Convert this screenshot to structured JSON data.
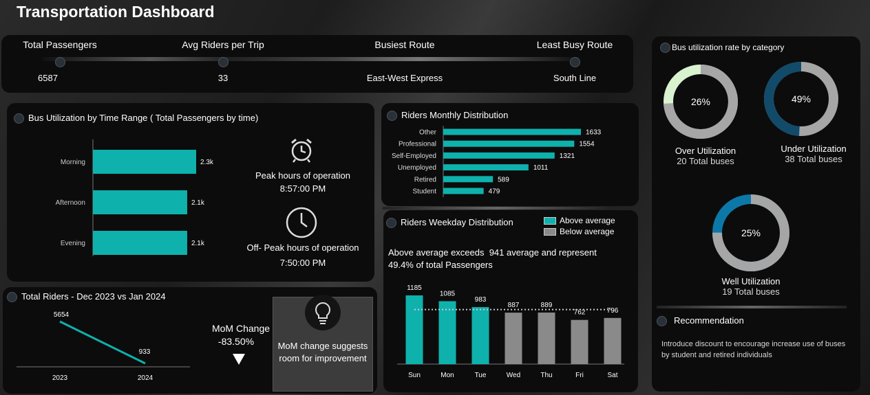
{
  "header": {
    "title": "Transportation Dashboard"
  },
  "kpis": [
    {
      "label": "Total Passengers",
      "value": "6587"
    },
    {
      "label": "Avg Riders per Trip",
      "value": "33"
    },
    {
      "label": "Busiest Route",
      "value": "East-West Express"
    },
    {
      "label": "Least Busy Route",
      "value": "South Line"
    }
  ],
  "time_range": {
    "title": "Bus Utilization by Time Range ( Total Passengers by time)",
    "peak_label": "Peak hours of operation",
    "peak_value": "8:57:00 PM",
    "offpeak_label": "Off- Peak hours of operation",
    "offpeak_value": "7:50:00 PM",
    "icons": {
      "peak": "alarm-clock-icon",
      "offpeak": "clock-icon"
    }
  },
  "monthly": {
    "title": "Riders Monthly Distribution"
  },
  "weekday": {
    "title": "Riders Weekday Distribution",
    "legend_above": "Above average",
    "legend_below": "Below average",
    "note_line1": "Above average exceeds  941 average and represent",
    "note_line2": "49.4% of total Passengers"
  },
  "total_riders": {
    "title": "Total Riders - Dec 2023 vs Jan 2024",
    "mom_label": "MoM Change",
    "mom_value": "-83.50%",
    "insight": "MoM change suggests room for improvement",
    "icon": "lightbulb-icon"
  },
  "utilization": {
    "title": "Bus utilization rate by category",
    "over_label": "Over Utilization",
    "over_sub": "20 Total buses",
    "over_pct": "26%",
    "under_label": "Under Utilization",
    "under_sub": "38 Total buses",
    "under_pct": "49%",
    "well_label": "Well Utilization",
    "well_sub": "19 Total buses",
    "well_pct": "25%"
  },
  "recommendation": {
    "title": "Recommendation",
    "text": "Introduce discount to encourage increase use of buses by student and retired individuals"
  },
  "colors": {
    "teal": "#0fb1ac",
    "gray": "#8a8a8a",
    "light_green": "#d9f2d0",
    "dark_teal": "#124a6a",
    "blue": "#0c78a8",
    "silver": "#a6a6a6"
  },
  "chart_data": [
    {
      "type": "bar",
      "orientation": "horizontal",
      "categories": [
        "Morning",
        "Afternoon",
        "Evening"
      ],
      "values": [
        2300,
        2100,
        2100
      ],
      "labels": [
        "2.3k",
        "2.1k",
        "2.1k"
      ]
    },
    {
      "type": "bar",
      "orientation": "horizontal",
      "categories": [
        "Other",
        "Professional",
        "Self-Employed",
        "Unemployed",
        "Retired",
        "Student"
      ],
      "values": [
        1633,
        1554,
        1321,
        1011,
        589,
        479
      ]
    },
    {
      "type": "bar",
      "categories": [
        "Sun",
        "Mon",
        "Tue",
        "Wed",
        "Thu",
        "Fri",
        "Sat"
      ],
      "values": [
        1185,
        1085,
        983,
        887,
        889,
        762,
        796
      ],
      "above_average": [
        true,
        true,
        true,
        false,
        false,
        false,
        false
      ],
      "average": 941
    },
    {
      "type": "line",
      "x": [
        "2023",
        "2024"
      ],
      "values": [
        5654,
        933
      ]
    },
    {
      "type": "pie",
      "slices": [
        {
          "name": "Over Utilization",
          "value": 26
        },
        {
          "name": "Under Utilization",
          "value": 49
        },
        {
          "name": "Well Utilization",
          "value": 25
        }
      ]
    }
  ]
}
